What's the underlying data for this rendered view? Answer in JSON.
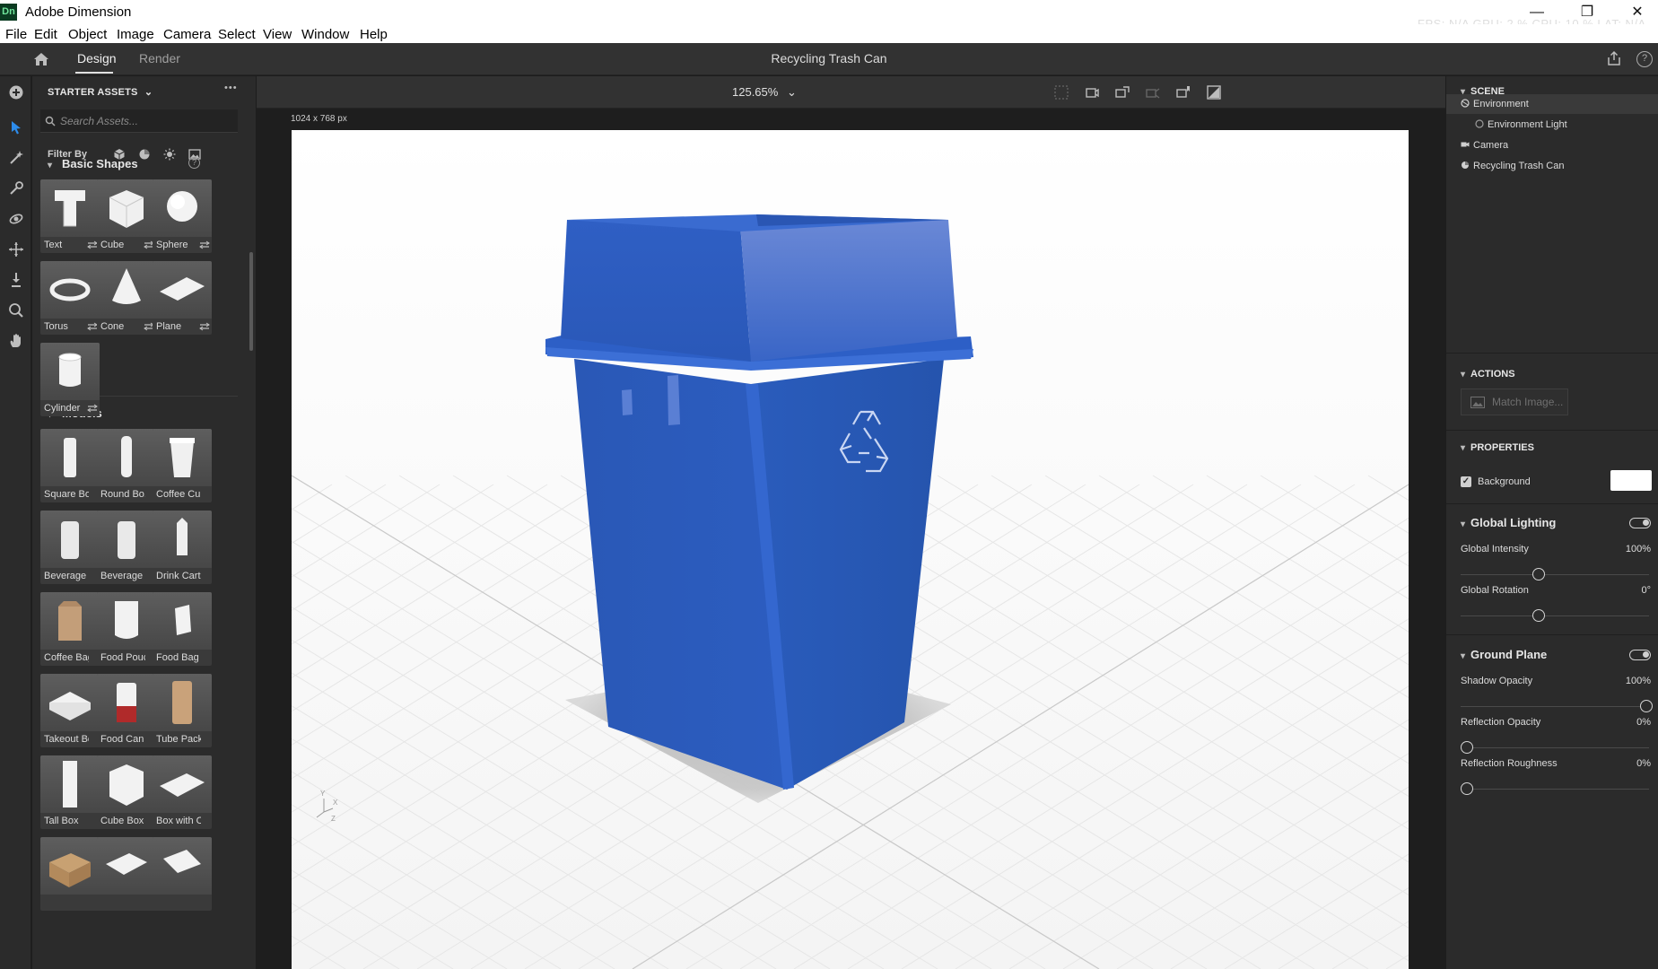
{
  "window": {
    "logo_text": "Dn",
    "app_title": "Adobe Dimension",
    "minimize": "—",
    "restore": "❐",
    "close": "✕",
    "stats_overlay": "FPS: N/A  GPU: 2 %  CPU: 10 %  LAT: N/A"
  },
  "menu": [
    "File",
    "Edit",
    "Object",
    "Image",
    "Camera",
    "Select",
    "View",
    "Window",
    "Help"
  ],
  "header": {
    "tabs": [
      "Design",
      "Render"
    ],
    "active_tab": "Design",
    "document_title": "Recycling Trash Can",
    "help": "?"
  },
  "assets": {
    "title": "STARTER ASSETS",
    "more": "•••",
    "search_placeholder": "Search Assets...",
    "filter_label": "Filter By",
    "sections": {
      "basic_shapes": "Basic Shapes",
      "models": "Models"
    },
    "basic_shapes": [
      "Text",
      "Cube",
      "Sphere",
      "Torus",
      "Cone",
      "Plane",
      "Cylinder"
    ],
    "models": [
      "Square Bo...",
      "Round Bo...",
      "Coffee Cup",
      "Beverage ...",
      "Beverage ...",
      "Drink Cart...",
      "Coffee Bag",
      "Food Pouch",
      "Food Bag",
      "Takeout Box",
      "Food Can",
      "Tube Pack...",
      "Tall Box",
      "Cube Box",
      "Box with O..."
    ]
  },
  "viewport": {
    "zoom": "125.65%",
    "canvas_size": "1024 x 768 px",
    "axis_y": "Y",
    "axis_x": "X",
    "axis_z": "Z"
  },
  "scene": {
    "title": "SCENE",
    "items": [
      "Environment",
      "Environment Light",
      "Camera",
      "Recycling Trash Can"
    ],
    "selected": "Environment"
  },
  "actions": {
    "title": "ACTIONS",
    "match_image": "Match Image..."
  },
  "properties": {
    "title": "PROPERTIES",
    "background_label": "Background",
    "background_color": "#ffffff",
    "background_checked": true,
    "global_lighting": {
      "title": "Global Lighting",
      "enabled": true,
      "intensity_label": "Global Intensity",
      "intensity_value": "100%",
      "intensity_fraction": 0.4,
      "rotation_label": "Global Rotation",
      "rotation_value": "0°",
      "rotation_fraction": 0.4
    },
    "ground_plane": {
      "title": "Ground Plane",
      "enabled": true,
      "shadow_label": "Shadow Opacity",
      "shadow_value": "100%",
      "shadow_fraction": 1.0,
      "reflection_label": "Reflection Opacity",
      "reflection_value": "0%",
      "reflection_fraction": 0,
      "roughness_label": "Reflection Roughness",
      "roughness_value": "0%",
      "roughness_fraction": 0
    }
  },
  "colors": {
    "accent": "#2d8ceb",
    "model_blue": "#2a5bb8"
  }
}
